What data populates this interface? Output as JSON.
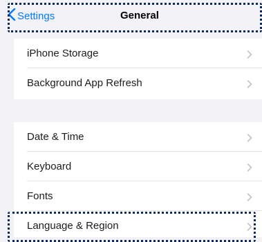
{
  "navbar": {
    "back_label": "Settings",
    "title": "General",
    "accent_color": "#007aff"
  },
  "groups": [
    {
      "items": [
        {
          "label": "iPhone Storage"
        },
        {
          "label": "Background App Refresh"
        }
      ]
    },
    {
      "items": [
        {
          "label": "Date & Time"
        },
        {
          "label": "Keyboard"
        },
        {
          "label": "Fonts"
        },
        {
          "label": "Language & Region"
        }
      ]
    }
  ],
  "icons": {
    "back": "chevron-left-icon",
    "disclosure": "chevron-right-icon"
  },
  "focus_highlight_color": "#0d2a5c"
}
